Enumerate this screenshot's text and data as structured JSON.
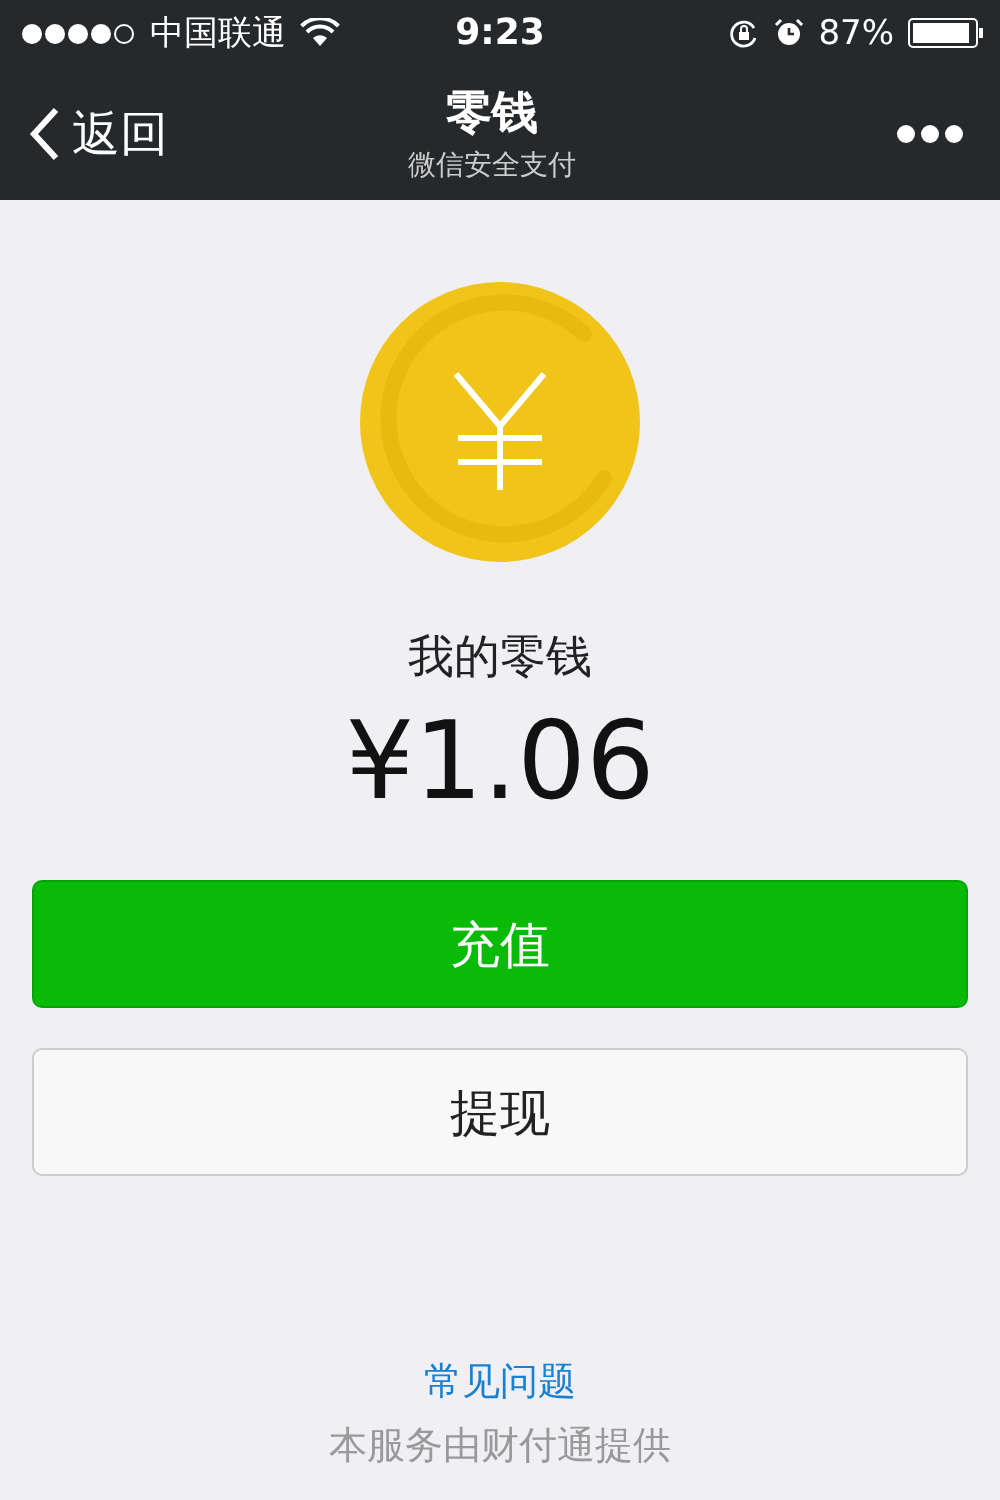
{
  "status_bar": {
    "carrier": "中国联通",
    "time": "9:23",
    "battery": "87%"
  },
  "nav": {
    "back": "返回",
    "title": "零钱",
    "subtitle": "微信安全支付"
  },
  "balance": {
    "label": "我的零钱",
    "amount": "¥1.06"
  },
  "buttons": [
    {
      "label": "充值",
      "kind": "primary"
    },
    {
      "label": "提现",
      "kind": "secondary"
    }
  ],
  "footer": {
    "link": "常见问题",
    "note": "本服务由财付通提供"
  }
}
